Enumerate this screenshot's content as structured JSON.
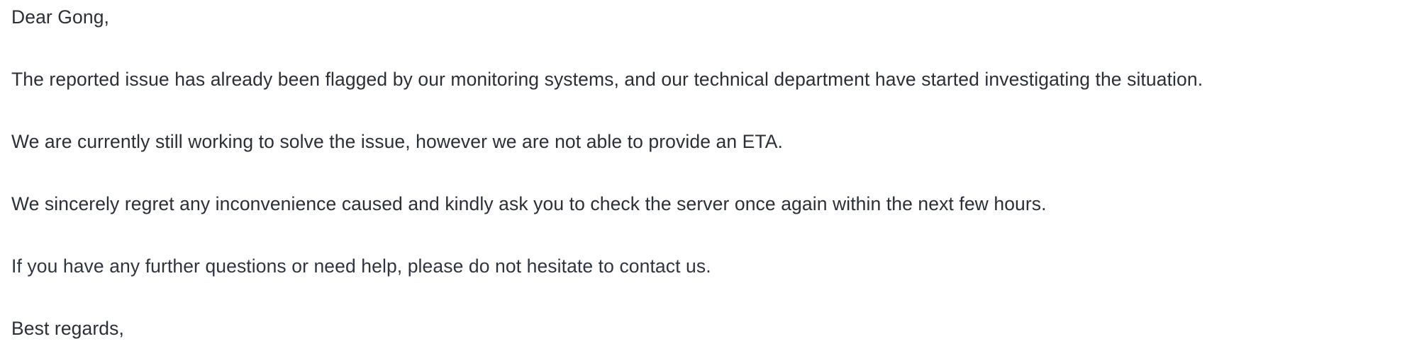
{
  "email": {
    "greeting": "Dear Gong,",
    "paragraphs": [
      "The reported issue has already been flagged by our monitoring systems, and our technical department have started investigating the situation.",
      "We are currently still working to solve the issue, however we are not able to provide an ETA.",
      "We sincerely regret any inconvenience caused and kindly ask you to check the server once again within the next few hours.",
      "If you have any further questions or need help, please do not hesitate to contact us."
    ],
    "closing": "Best regards,"
  }
}
